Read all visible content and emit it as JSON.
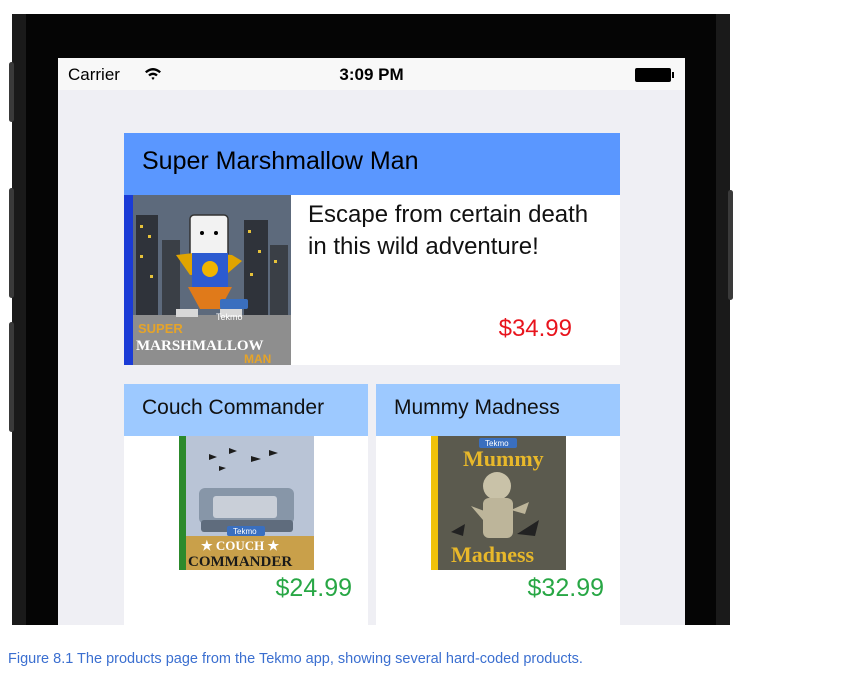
{
  "status_bar": {
    "carrier": "Carrier",
    "time": "3:09 PM",
    "wifi_icon": "wifi-icon",
    "battery_icon": "battery-icon"
  },
  "featured": {
    "title": "Super Marshmallow Man",
    "description": "Escape from certain death in this wild adventure!",
    "price": "$34.99",
    "image": {
      "brand": "Tekmo",
      "line1": "SUPER",
      "line2": "MARSHMALLOW",
      "line3": "MAN"
    }
  },
  "products": [
    {
      "title": "Couch Commander",
      "price": "$24.99",
      "image": {
        "brand": "Tekmo",
        "line1": "★ COUCH ★",
        "line2": "COMMANDER"
      }
    },
    {
      "title": "Mummy Madness",
      "price": "$32.99",
      "image": {
        "brand": "Tekmo",
        "line1": "Mummy",
        "line2": "Madness"
      }
    }
  ],
  "caption": "Figure 8.1 The products page from the Tekmo app, showing several hard-coded products.",
  "colors": {
    "featured_header": "#5a97ff",
    "small_header": "#9dc9ff",
    "featured_price": "#e8141d",
    "small_price": "#28a745",
    "caption": "#3b6fd0"
  }
}
